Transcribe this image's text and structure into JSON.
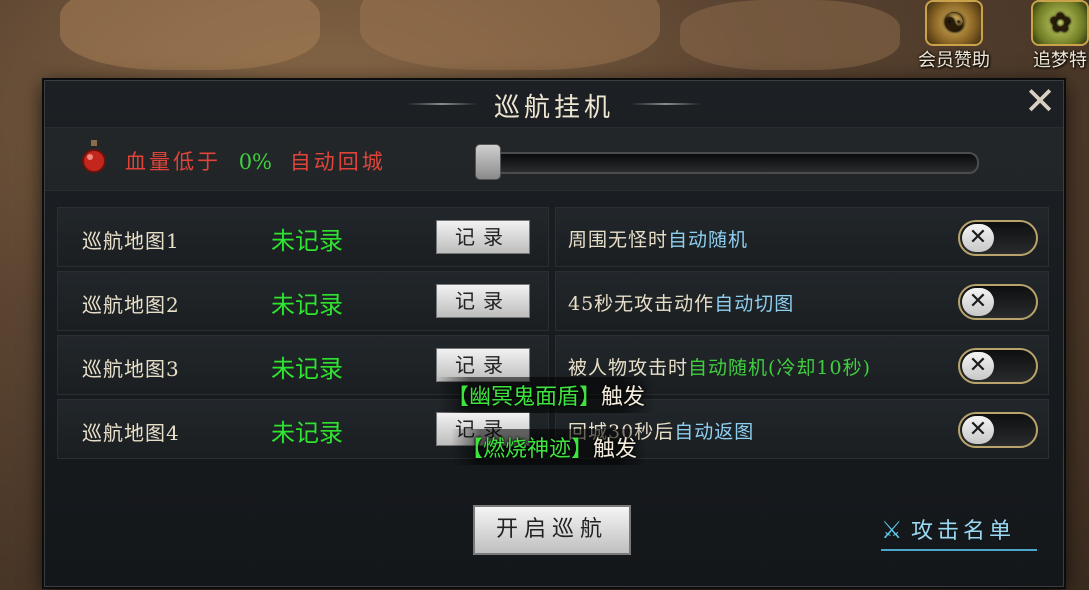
{
  "hud": {
    "member_help": "会员赞助",
    "chase_dream": "追梦特"
  },
  "panel": {
    "title": "巡航挂机",
    "hp": {
      "prefix": "血量低于",
      "percent": "0%",
      "suffix": "自动回城",
      "slider_value": 0
    },
    "maps": [
      {
        "label": "巡航地图1",
        "status": "未记录",
        "button": "记录"
      },
      {
        "label": "巡航地图2",
        "status": "未记录",
        "button": "记录"
      },
      {
        "label": "巡航地图3",
        "status": "未记录",
        "button": "记录"
      },
      {
        "label": "巡航地图4",
        "status": "未记录",
        "button": "记录"
      }
    ],
    "options": [
      {
        "pre": "周围无怪时",
        "hl": "自动随机",
        "on": false
      },
      {
        "pre": "45秒无攻击动作",
        "hl": "自动切图",
        "on": false
      },
      {
        "pre": "被人物攻击时",
        "hl": "自动随机(冷却10秒)",
        "on": false
      },
      {
        "pre": "回城30秒后",
        "hl": "自动返图",
        "on": false
      }
    ],
    "toasts": [
      {
        "name": "【幽冥鬼面盾】",
        "trigger": "触发"
      },
      {
        "name": "【燃烧神迹】",
        "trigger": "触发"
      }
    ],
    "start_button": "开启巡航",
    "attack_list": "攻击名单",
    "toggle_off_glyph": "✕"
  },
  "colors": {
    "accent_green": "#2fe22f",
    "hp_red": "#e04438",
    "highlight_blue": "#8ecff0"
  }
}
